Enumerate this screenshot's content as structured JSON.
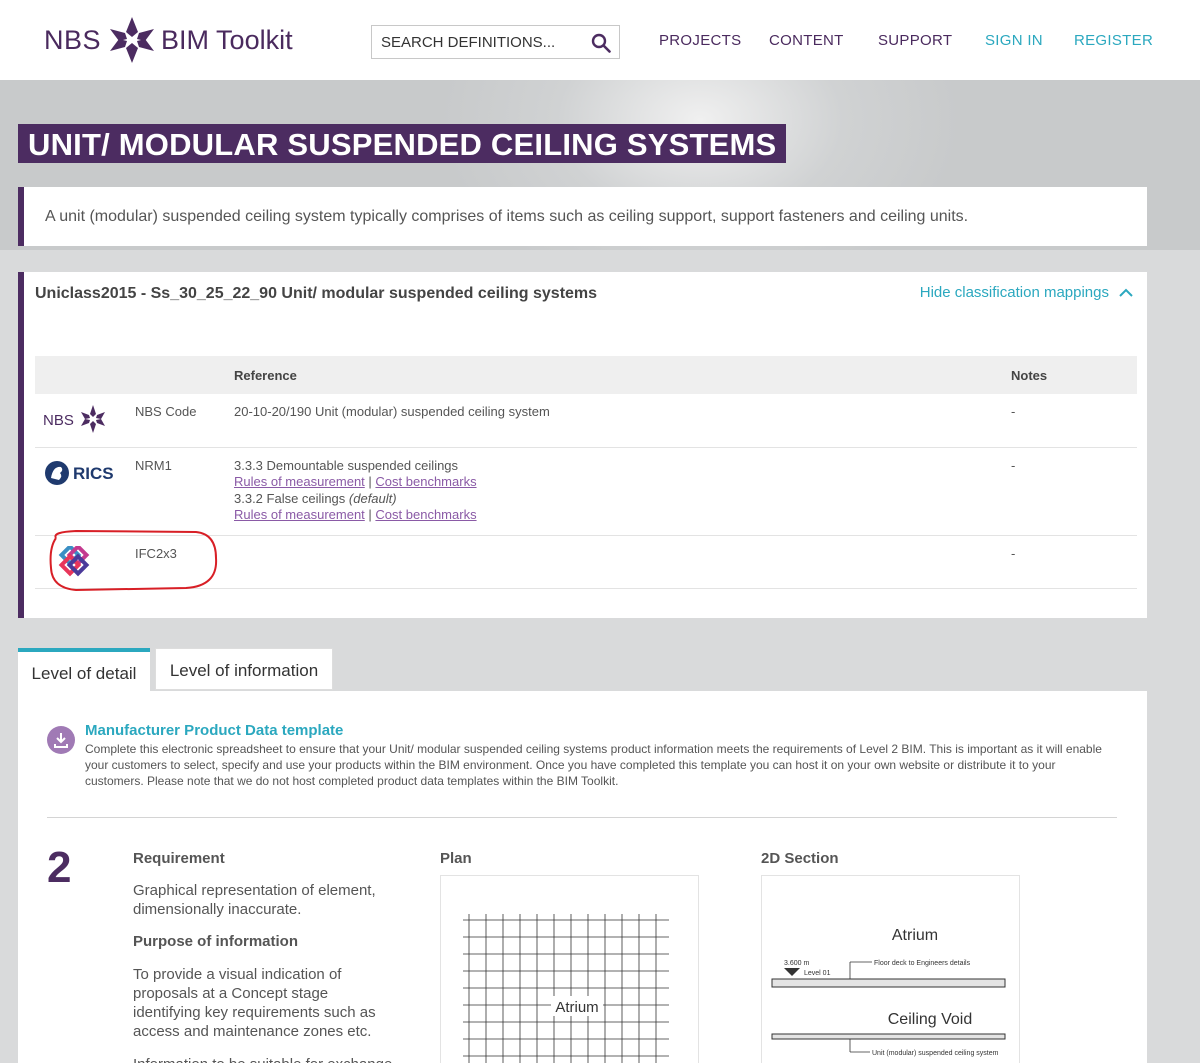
{
  "header": {
    "logo_left": "NBS",
    "logo_right": "BIM Toolkit",
    "search_placeholder": "SEARCH DEFINITIONS...",
    "nav": {
      "projects": "PROJECTS",
      "content": "CONTENT",
      "support": "SUPPORT",
      "sign_in": "SIGN IN",
      "register": "REGISTER"
    }
  },
  "page_title": "UNIT/ MODULAR SUSPENDED CEILING SYSTEMS",
  "description": "A unit (modular) suspended ceiling system typically comprises of items such as ceiling support, support fasteners and ceiling units.",
  "classification": {
    "title": "Uniclass2015 - Ss_30_25_22_90 Unit/ modular suspended ceiling systems",
    "hide_link": "Hide classification mappings",
    "headers": {
      "reference": "Reference",
      "notes": "Notes"
    },
    "rows": [
      {
        "logo": "nbs-logo",
        "code": "NBS Code",
        "ref": "20-10-20/190 Unit (modular) suspended ceiling system",
        "notes": "-"
      },
      {
        "logo": "rics-logo",
        "code": "NRM1",
        "ref1": "3.3.3 Demountable suspended ceilings",
        "link_rules": "Rules of measurement",
        "link_cost": "Cost benchmarks",
        "sep": "|",
        "ref2": "3.3.2 False ceilings",
        "ref2_suffix": "(default)",
        "notes": "-"
      },
      {
        "logo": "ifc-logo",
        "code": "IFC2x3",
        "notes": "-"
      }
    ]
  },
  "tabs": {
    "active": "Level of detail",
    "inactive": "Level of information"
  },
  "mpdt": {
    "title": "Manufacturer Product Data template",
    "text": "Complete this electronic spreadsheet to ensure that your Unit/ modular suspended ceiling systems product information meets the requirements of Level 2 BIM. This is important as it will enable your customers to select, specify and use your products within the BIM environment. Once you have completed this template you can host it on your own website or distribute it to your customers. Please note that we do not host completed product data templates within the BIM Toolkit."
  },
  "detail": {
    "level": "2",
    "requirement_h": "Requirement",
    "requirement_t": "Graphical representation of element, dimensionally inaccurate.",
    "purpose_h": "Purpose of information",
    "purpose_t": "To provide a visual indication of proposals at a Concept stage identifying key requirements such as access and maintenance zones etc.",
    "extra_t": "Information to be suitable for exchange",
    "plan_h": "Plan",
    "section_h": "2D Section",
    "plan_label": "Atrium",
    "sec_atrium": "Atrium",
    "sec_level_value": "3.600 m",
    "sec_level_name": "Level 01",
    "sec_floor_note": "Floor deck to Engineers details",
    "sec_void": "Ceiling Void",
    "sec_ceiling_note": "Unit (modular) suspended ceiling system"
  },
  "colors": {
    "brand_purple": "#4c2c61",
    "teal": "#2ba8bf",
    "annotation_red": "#d81f26"
  }
}
